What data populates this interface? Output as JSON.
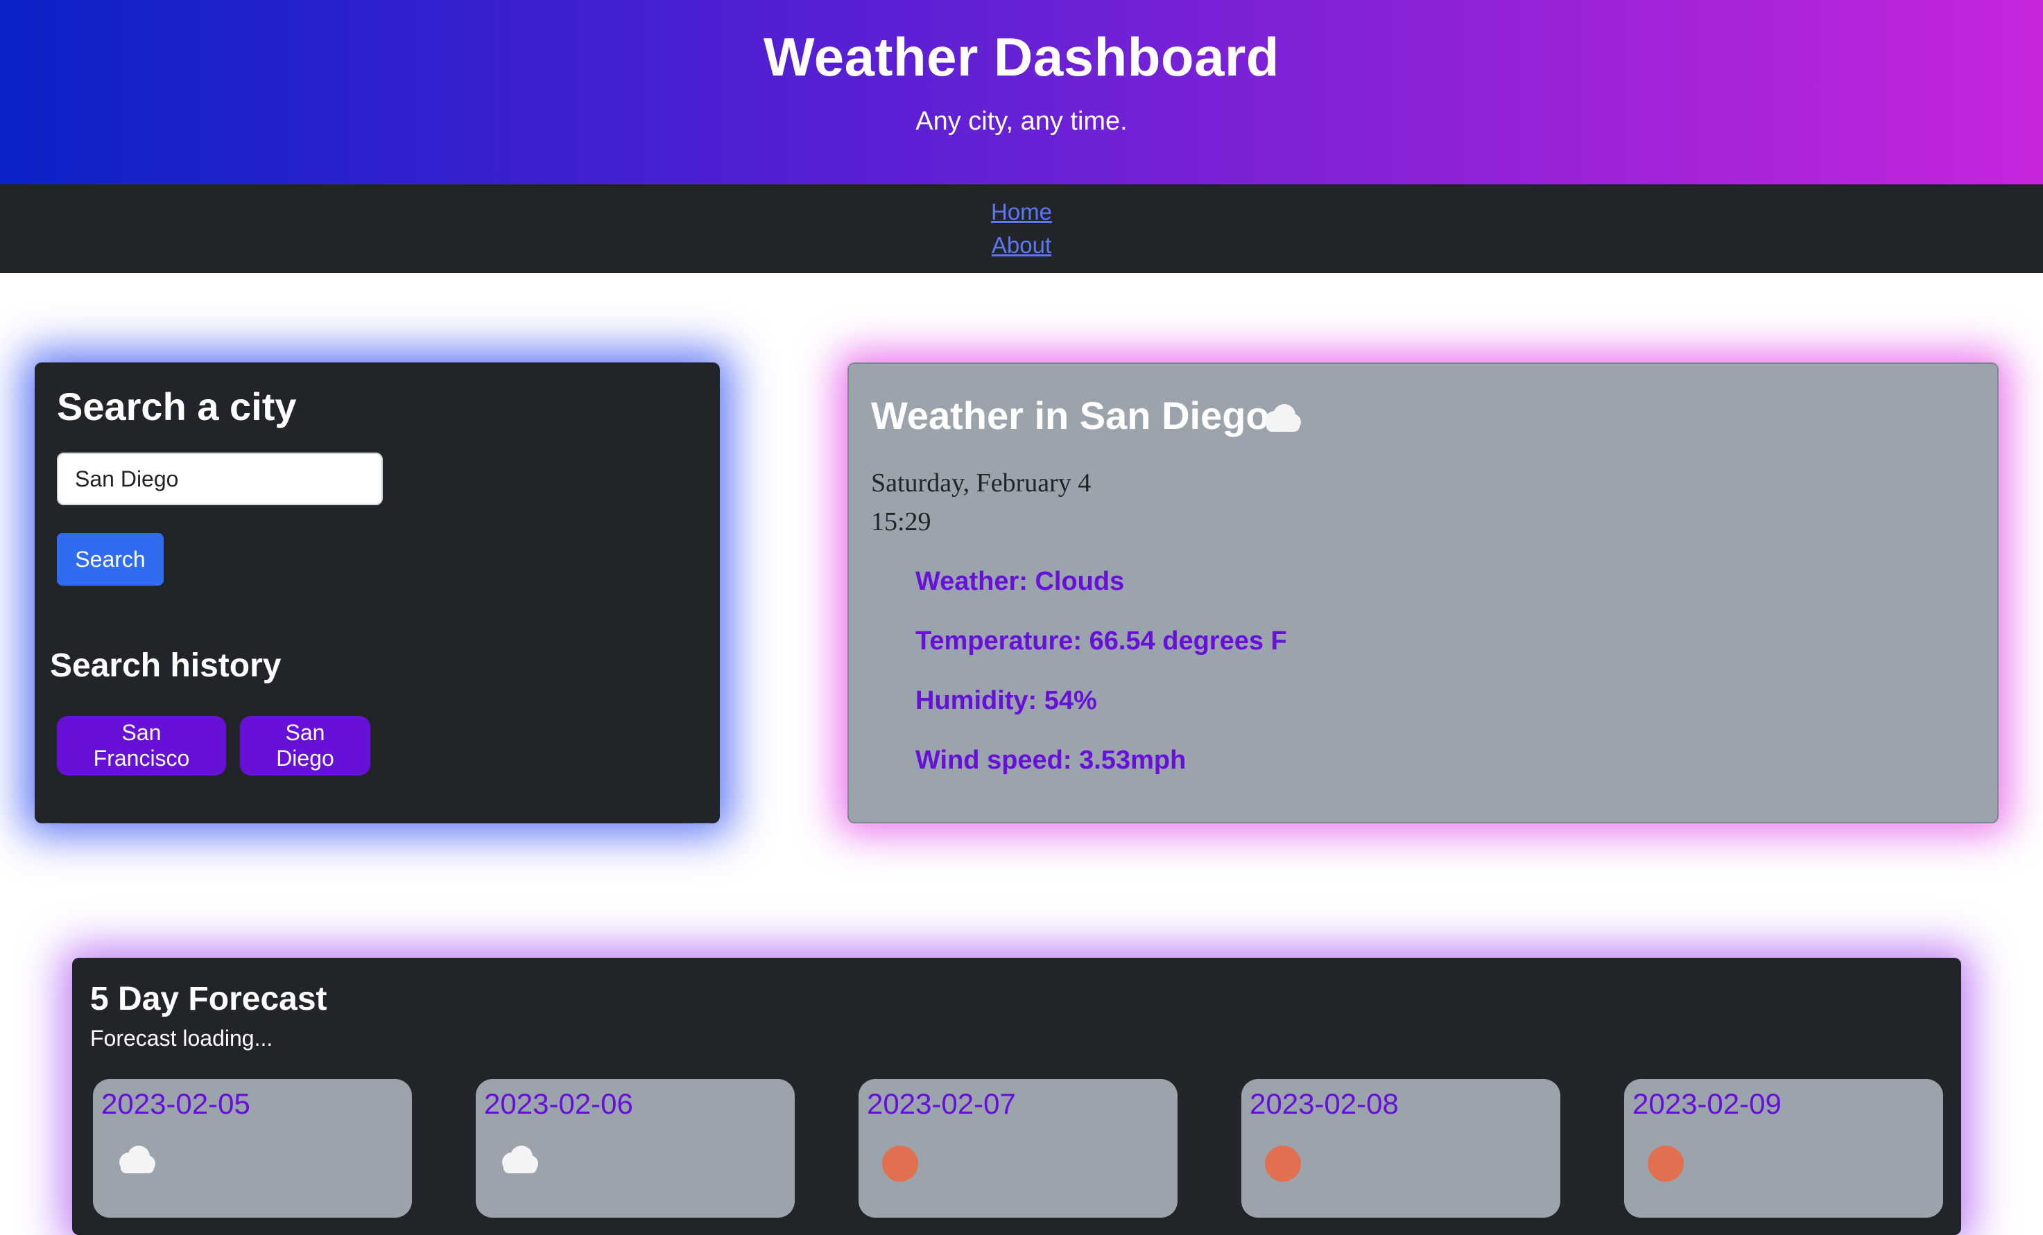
{
  "header": {
    "title": "Weather Dashboard",
    "subtitle": "Any city, any time."
  },
  "nav": {
    "links": [
      {
        "label": "Home"
      },
      {
        "label": "About"
      }
    ]
  },
  "search": {
    "title": "Search a city",
    "input_value": "San Diego",
    "button_label": "Search",
    "history_title": "Search history",
    "history": [
      "San Francisco",
      "San Diego"
    ]
  },
  "current": {
    "title": "Weather in San Diego",
    "icon": "cloud-icon",
    "date": "Saturday, February 4",
    "time": "15:29",
    "weather": "Weather: Clouds",
    "temperature": "Temperature: 66.54 degrees F",
    "humidity": "Humidity: 54%",
    "wind": "Wind speed: 3.53mph"
  },
  "forecast": {
    "title": "5 Day Forecast",
    "status": "Forecast loading...",
    "days": [
      {
        "date": "2023-02-05",
        "icon": "cloud-icon"
      },
      {
        "date": "2023-02-06",
        "icon": "cloud-icon"
      },
      {
        "date": "2023-02-07",
        "icon": "sun-icon"
      },
      {
        "date": "2023-02-08",
        "icon": "sun-icon"
      },
      {
        "date": "2023-02-09",
        "icon": "sun-icon"
      }
    ]
  },
  "colors": {
    "accent_purple": "#6610d8",
    "button_blue": "#2f6cf0",
    "card_dark": "#212529",
    "card_gray": "#9ba3ad",
    "sun": "#e07050"
  }
}
